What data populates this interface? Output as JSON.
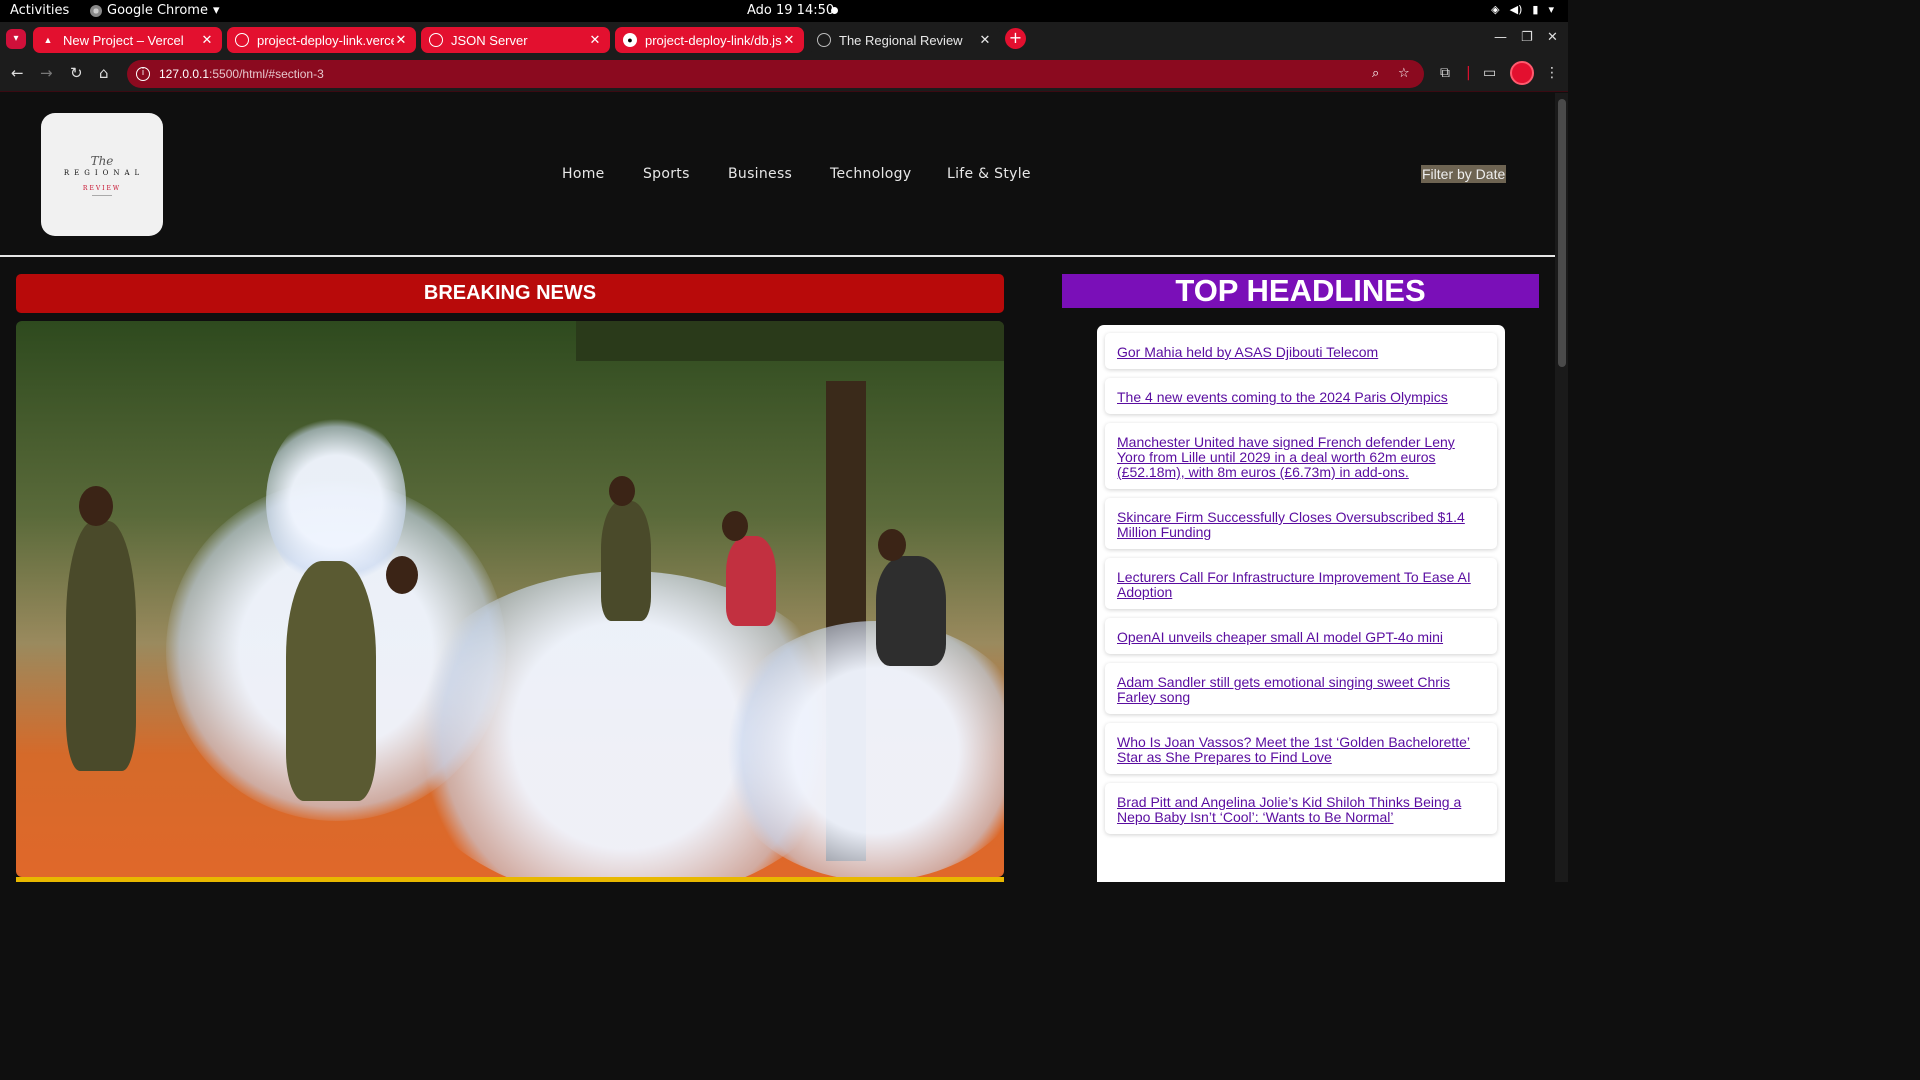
{
  "system": {
    "activities": "Activities",
    "app_name": "Google Chrome",
    "clock": "Ado 19  14:50"
  },
  "tabs": [
    {
      "title": "New Project – Vercel",
      "active": false,
      "icon": "vercel-triangle-icon"
    },
    {
      "title": "project-deploy-link.vercel",
      "active": false,
      "icon": "site-icon"
    },
    {
      "title": "JSON Server",
      "active": false,
      "icon": "site-icon"
    },
    {
      "title": "project-deploy-link/db.js",
      "active": false,
      "icon": "github-icon"
    },
    {
      "title": "The Regional Review",
      "active": true,
      "icon": "globe-icon"
    }
  ],
  "address_bar": {
    "host": "127.0.0.1",
    "path": ":5500/html/#section-3"
  },
  "site": {
    "logo": {
      "script": "The",
      "main": "REGIONAL",
      "sub": "REVIEW"
    },
    "nav": [
      "Home",
      "Sports",
      "Business",
      "Technology",
      "Life & Style"
    ],
    "filter_label": "Filter by Date",
    "breaking_title": "BREAKING NEWS",
    "top_headlines_title": "TOP HEADLINES",
    "headlines": [
      "Gor Mahia held by ASAS Djibouti Telecom",
      "The 4 new events coming to the 2024 Paris Olympics",
      "Manchester United have signed French defender Leny Yoro from Lille until 2029 in a deal worth 62m euros (£52.18m), with 8m euros (£6.73m) in add-ons.",
      "Skincare Firm Successfully Closes Oversubscribed $1.4 Million Funding",
      "Lecturers Call For Infrastructure Improvement To Ease AI Adoption",
      "OpenAI unveils cheaper small AI model GPT-4o mini",
      "Adam Sandler still gets emotional singing sweet Chris Farley song",
      "Who Is Joan Vassos? Meet the 1st ‘Golden Bachelorette’ Star as She Prepares to Find Love",
      "Brad Pitt and Angelina Jolie’s Kid Shiloh Thinks Being a Nepo Baby Isn’t ‘Cool’: ‘Wants to Be Normal’"
    ]
  },
  "colors": {
    "accent_red": "#e3102f",
    "breaking_red": "#b80a0a",
    "headlines_purple": "#7a0fb8",
    "link_purple": "#5a0da0"
  }
}
